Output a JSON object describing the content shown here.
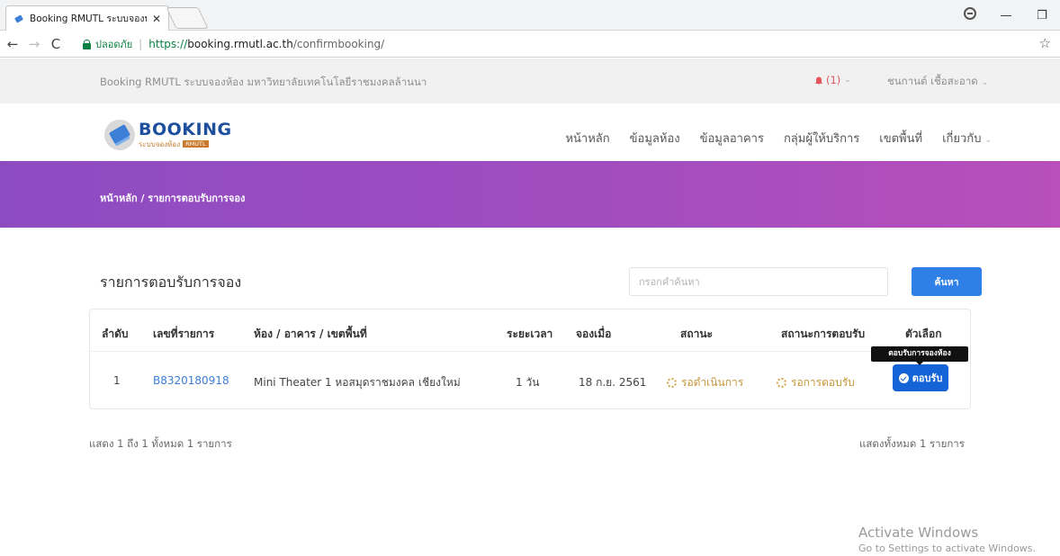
{
  "browser": {
    "tab_title": "Booking RMUTL ระบบจองห้",
    "tab_close": "✕",
    "window_buttons": {
      "minimize": "—",
      "restore": "❐"
    },
    "nav": {
      "back": "←",
      "forward": "→",
      "reload": "C"
    },
    "secure_label": "ปลอดภัย",
    "url_scheme": "https://",
    "url_host": "booking.rmutl.ac.th",
    "url_path": "/confirmbooking/",
    "star": "☆"
  },
  "topbar": {
    "site_text": "Booking RMUTL ระบบจองห้อง มหาวิทยาลัยเทคโนโลยีราชมงคลล้านนา",
    "notification_count": "(1)",
    "user_name": "ชนกานต์ เชื้อสะอาด"
  },
  "logo": {
    "title": "BOOKING",
    "subtitle": "ระบบจองห้อง",
    "tag": "RMUTL"
  },
  "nav": {
    "items": [
      "หน้าหลัก",
      "ข้อมูลห้อง",
      "ข้อมูลอาคาร",
      "กลุ่มผู้ให้บริการ",
      "เขตพื้นที่",
      "เกี่ยวกับ"
    ]
  },
  "breadcrumb": {
    "home": "หน้าหลัก",
    "separator": " / ",
    "current": "รายการตอบรับการจอง"
  },
  "main": {
    "title": "รายการตอบรับการจอง",
    "search_placeholder": "กรอกคำค้นหา",
    "search_button": "ค้นหา"
  },
  "table": {
    "headers": [
      "ลำดับ",
      "เลขที่รายการ",
      "ห้อง / อาคาร / เขตพื้นที่",
      "ระยะเวลา",
      "จองเมื่อ",
      "สถานะ",
      "สถานะการตอบรับ",
      "ตัวเลือก"
    ],
    "rows": [
      {
        "index": "1",
        "booking_no": "B8320180918",
        "room": "Mini Theater 1 หอสมุดราชมงคล เชียงใหม่",
        "duration": "1 วัน",
        "booked_on": "18 ก.ย. 2561",
        "status": "รอดำเนินการ",
        "response_status": "รอการตอบรับ",
        "action_label": "ตอบรับ"
      }
    ],
    "tooltip": "ตอบรับการจองห้อง"
  },
  "summary": {
    "left": "แสดง 1 ถึง 1 ทั้งหมด 1 รายการ",
    "right": "แสดงทั้งหมด 1 รายการ"
  },
  "watermark": {
    "title": "Activate Windows",
    "subtitle": "Go to Settings to activate Windows."
  },
  "colors": {
    "banner_start": "#8d4bc2",
    "banner_end": "#b84fbb",
    "primary_button": "#2f80e6",
    "accept_button": "#1464d8",
    "link": "#3e7dd6",
    "pending": "#c8963a",
    "notification": "#e0565b"
  }
}
